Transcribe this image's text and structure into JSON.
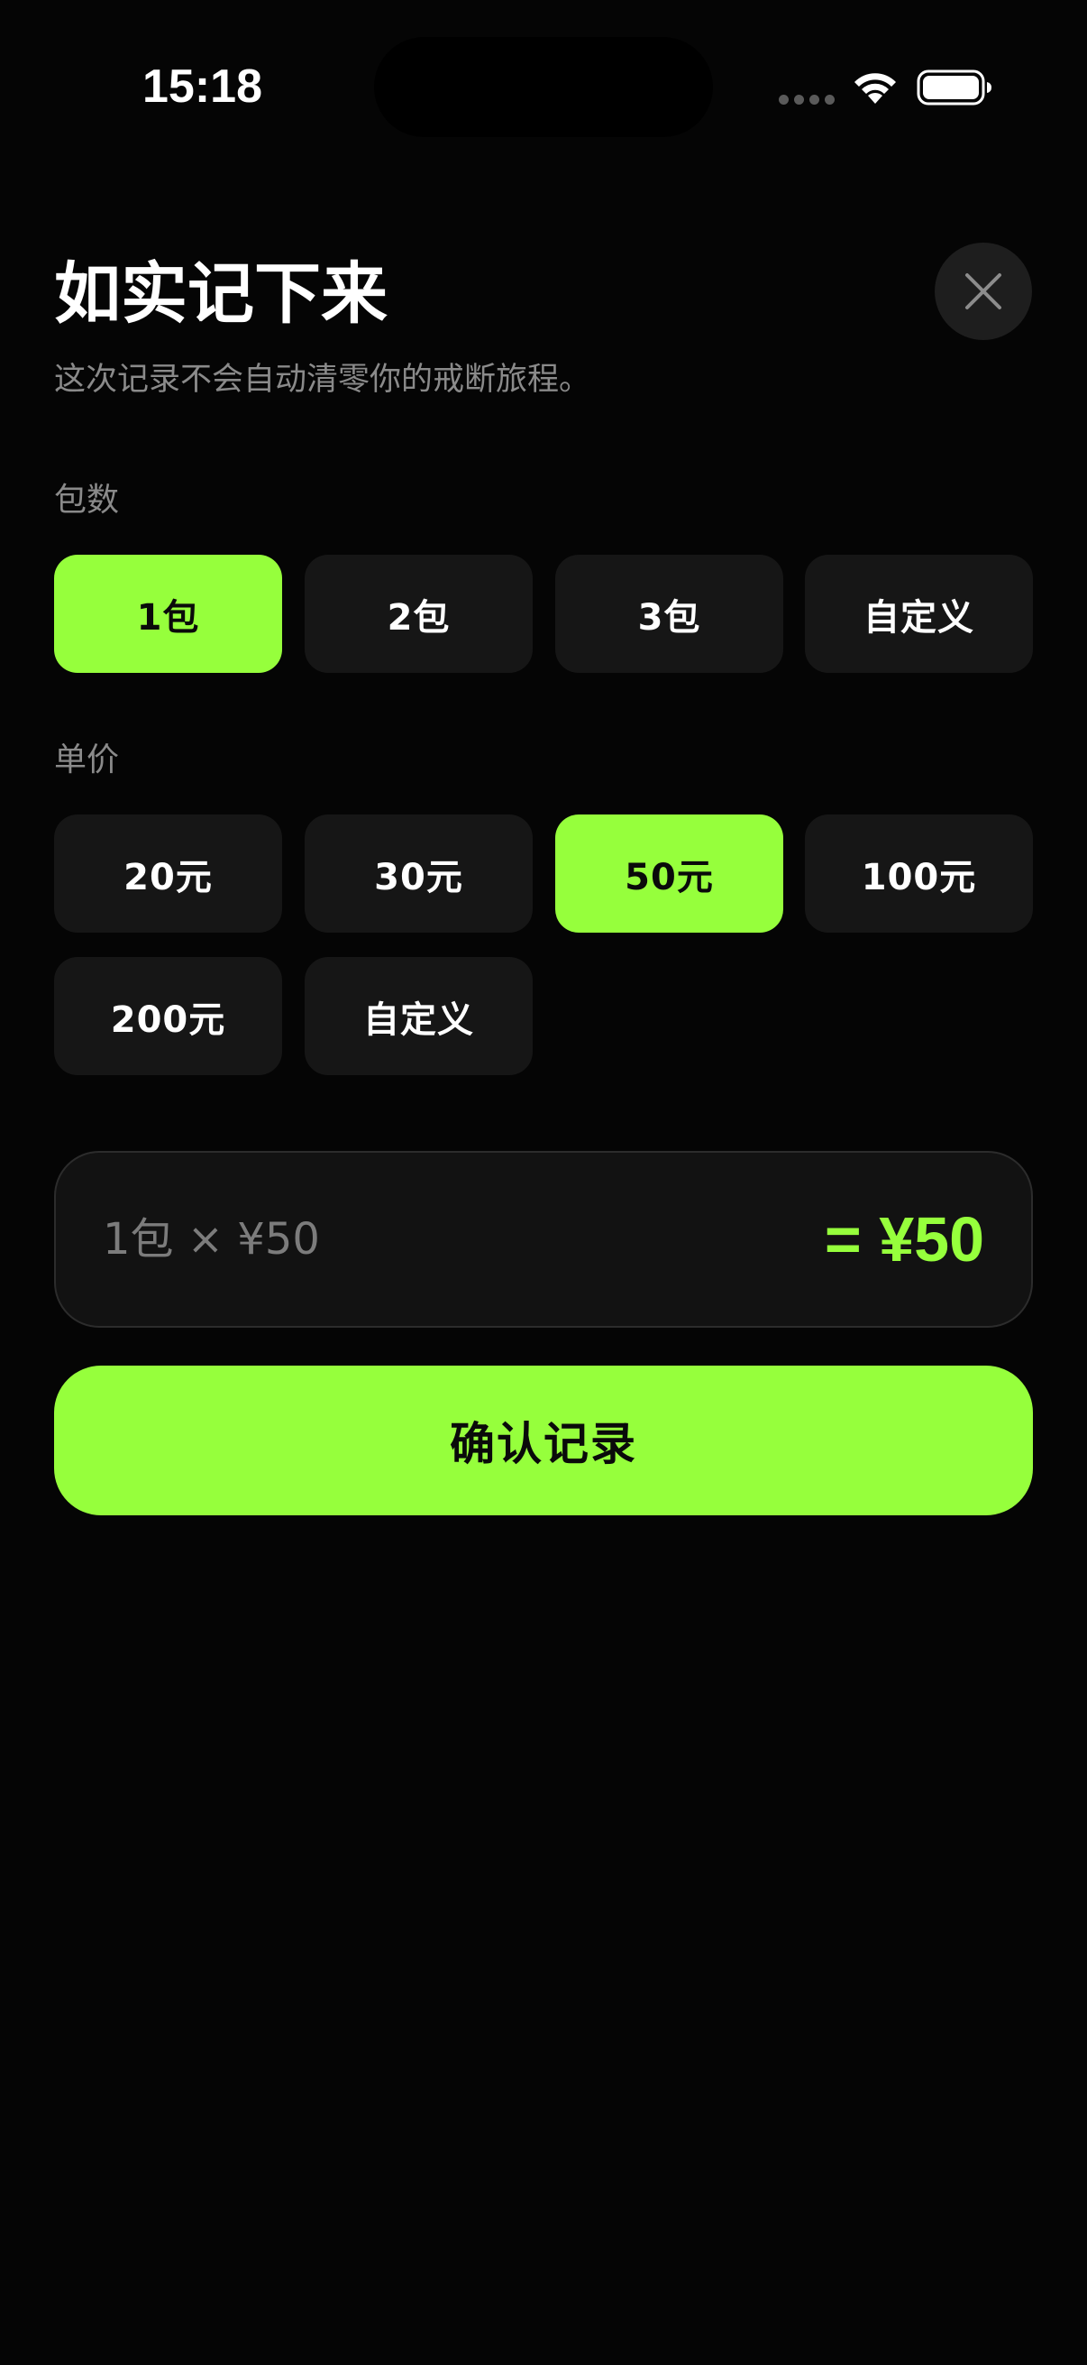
{
  "status_bar": {
    "time": "15:18",
    "icons": [
      "signal-dots-icon",
      "wifi-icon",
      "battery-icon"
    ]
  },
  "header": {
    "title": "如实记下来",
    "subtitle": "这次记录不会自动清零你的戒断旅程。",
    "close_icon": "close-icon"
  },
  "packs": {
    "label": "包数",
    "options": [
      "1包",
      "2包",
      "3包",
      "自定义"
    ],
    "selected": "1包"
  },
  "price": {
    "label": "单价",
    "options": [
      "20元",
      "30元",
      "50元",
      "100元",
      "200元",
      "自定义"
    ],
    "selected": "50元"
  },
  "summary": {
    "formula": "1包 × ¥50",
    "total": "= ¥50"
  },
  "confirm": {
    "label": "确认记录"
  },
  "colors": {
    "accent": "#96ff3c",
    "background": "#050505",
    "chip": "#161616",
    "muted_text": "#8a8a8a"
  }
}
